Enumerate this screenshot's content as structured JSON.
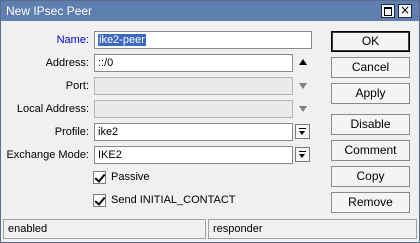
{
  "window": {
    "title": "New IPsec Peer"
  },
  "form": {
    "name": {
      "label": "Name:",
      "value": "ike2-peer"
    },
    "address": {
      "label": "Address:",
      "value": "::/0"
    },
    "port": {
      "label": "Port:",
      "value": ""
    },
    "local_address": {
      "label": "Local Address:",
      "value": ""
    },
    "profile": {
      "label": "Profile:",
      "value": "ike2"
    },
    "exchange_mode": {
      "label": "Exchange Mode:",
      "value": "IKE2"
    },
    "passive": {
      "label": "Passive",
      "checked": true
    },
    "send_initial_contact": {
      "label": "Send INITIAL_CONTACT",
      "checked": true
    }
  },
  "buttons": {
    "ok": "OK",
    "cancel": "Cancel",
    "apply": "Apply",
    "disable": "Disable",
    "comment": "Comment",
    "copy": "Copy",
    "remove": "Remove"
  },
  "status": {
    "left": "enabled",
    "right": "responder"
  },
  "colors": {
    "titlebar": "#5f7fb0",
    "selection": "#3c69c5",
    "focus_label": "#0000cc"
  }
}
